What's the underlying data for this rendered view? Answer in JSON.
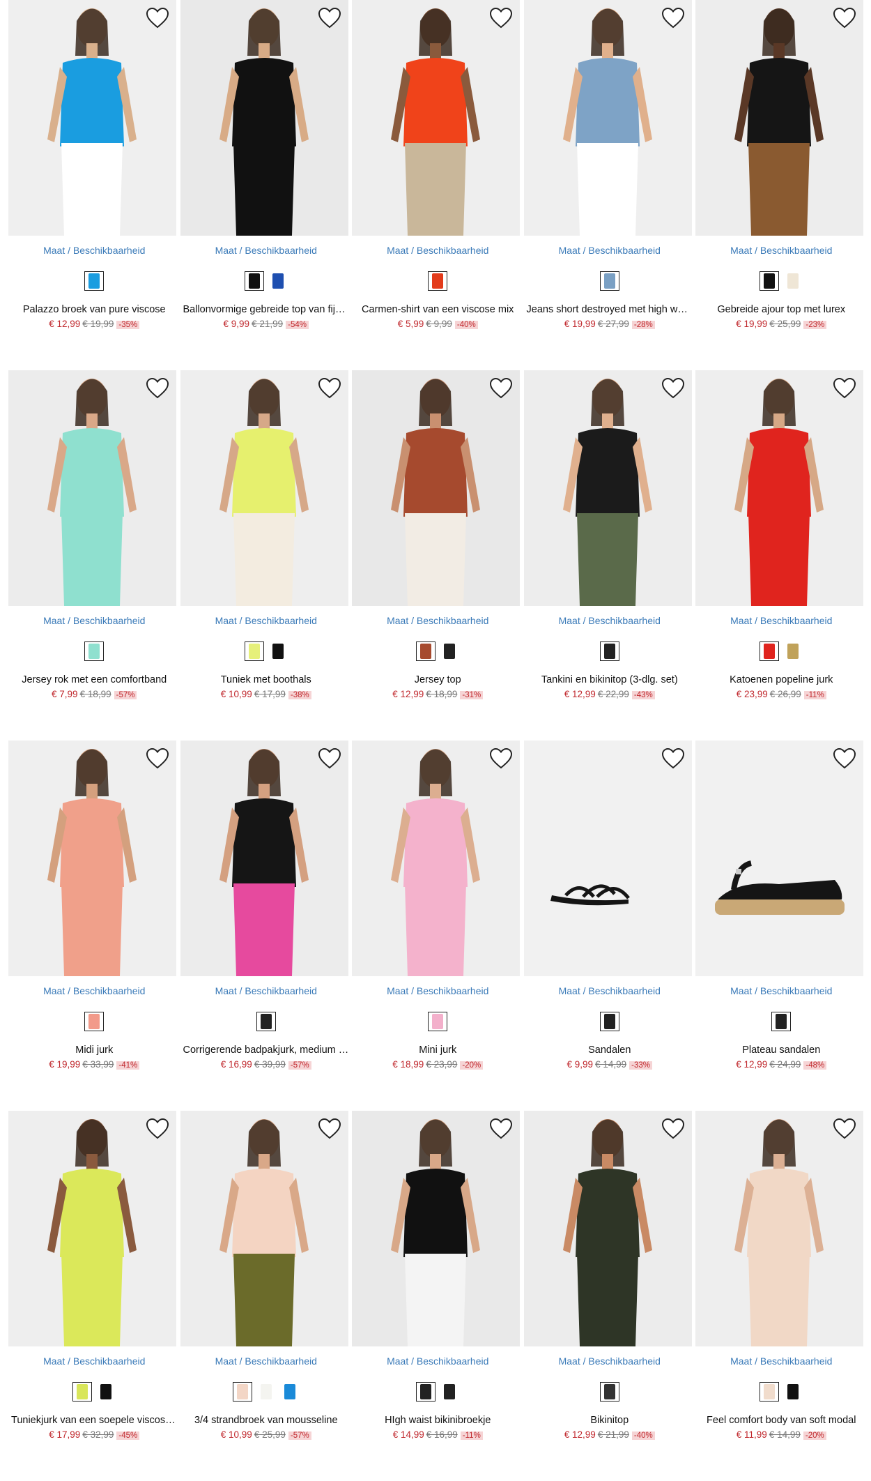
{
  "availability_label": "Maat / Beschikbaarheid",
  "products": [
    {
      "name": "Palazzo broek van pure viscose",
      "price": "€ 12,99",
      "old_price": "€ 19,99",
      "discount": "-35%",
      "swatches": [
        "#1a9de0"
      ],
      "bg": "#efefef",
      "main": "#1a9de0",
      "sub": "#ffffff",
      "skin": "#d9b08c"
    },
    {
      "name": "Ballonvormige gebreide top van fijn tricot",
      "price": "€ 9,99",
      "old_price": "€ 21,99",
      "discount": "-54%",
      "swatches": [
        "#111111",
        "#1e4fb0"
      ],
      "bg": "#e9e9e9",
      "main": "#111111",
      "sub": "#111111",
      "skin": "#d8ab86"
    },
    {
      "name": "Carmen-shirt van een viscose mix",
      "price": "€ 5,99",
      "old_price": "€ 9,99",
      "discount": "-40%",
      "swatches": [
        "#e33b1b"
      ],
      "bg": "#eeeeee",
      "main": "#f0431a",
      "sub": "#c9b79a",
      "skin": "#8a5a3c"
    },
    {
      "name": "Jeans short destroyed met high waist",
      "price": "€ 19,99",
      "old_price": "€ 27,99",
      "discount": "-28%",
      "swatches": [
        "#7aa0c4"
      ],
      "bg": "#efefef",
      "main": "#7ea3c6",
      "sub": "#ffffff",
      "skin": "#e0b08c"
    },
    {
      "name": "Gebreide ajour top met lurex",
      "price": "€ 19,99",
      "old_price": "€ 25,99",
      "discount": "-23%",
      "swatches": [
        "#111111",
        "#efe6d6"
      ],
      "bg": "#ededed",
      "main": "#151515",
      "sub": "#8a5a30",
      "skin": "#5a3826"
    },
    {
      "name": "Jersey rok met een comfortband",
      "price": "€ 7,99",
      "old_price": "€ 18,99",
      "discount": "-57%",
      "swatches": [
        "#8fe0cf"
      ],
      "bg": "#ececec",
      "main": "#8fe0cf",
      "sub": "#8fe0cf",
      "skin": "#d9a888"
    },
    {
      "name": "Tuniek met boothals",
      "price": "€ 10,99",
      "old_price": "€ 17,99",
      "discount": "-38%",
      "swatches": [
        "#e6f07a",
        "#111111"
      ],
      "bg": "#eeeeee",
      "main": "#e6f06e",
      "sub": "#f3ece0",
      "skin": "#d6a888"
    },
    {
      "name": "Jersey top",
      "price": "€ 12,99",
      "old_price": "€ 18,99",
      "discount": "-31%",
      "swatches": [
        "#a64a2e",
        "#222222"
      ],
      "bg": "#e8e8e8",
      "main": "#a64a2e",
      "sub": "#f2ece4",
      "skin": "#c99070"
    },
    {
      "name": "Tankini en bikinitop (3-dlg. set)",
      "price": "€ 12,99",
      "old_price": "€ 22,99",
      "discount": "-43%",
      "swatches": [
        "#222222"
      ],
      "bg": "#ededed",
      "main": "#1b1b1b",
      "sub": "#5a6a4a",
      "skin": "#e0b08e"
    },
    {
      "name": "Katoenen popeline jurk",
      "price": "€ 23,99",
      "old_price": "€ 26,99",
      "discount": "-11%",
      "swatches": [
        "#e0241e",
        "#c0a25a"
      ],
      "bg": "#eeeeee",
      "main": "#e0241e",
      "sub": "#e0241e",
      "skin": "#d6a886"
    },
    {
      "name": "Midi jurk",
      "price": "€ 19,99",
      "old_price": "€ 33,99",
      "discount": "-41%",
      "swatches": [
        "#f29a8a"
      ],
      "bg": "#efefef",
      "main": "#f0a08a",
      "sub": "#f0a08a",
      "skin": "#d4a07e"
    },
    {
      "name": "Corrigerende badpakjurk, medium shape",
      "price": "€ 16,99",
      "old_price": "€ 39,99",
      "discount": "-57%",
      "swatches": [
        "#222222"
      ],
      "bg": "#ececec",
      "main": "#151515",
      "sub": "#e64a9e",
      "skin": "#d4a080"
    },
    {
      "name": "Mini jurk",
      "price": "€ 18,99",
      "old_price": "€ 23,99",
      "discount": "-20%",
      "swatches": [
        "#f3b0cb"
      ],
      "bg": "#eeeeee",
      "main": "#f4b2cc",
      "sub": "#f4b2cc",
      "skin": "#dcae90"
    },
    {
      "name": "Sandalen",
      "price": "€ 9,99",
      "old_price": "€ 14,99",
      "discount": "-33%",
      "swatches": [
        "#222222"
      ],
      "bg": "#f1f1f1",
      "main": "#151515",
      "sub": "#151515",
      "skin": "#f1f1f1"
    },
    {
      "name": "Plateau sandalen",
      "price": "€ 12,99",
      "old_price": "€ 24,99",
      "discount": "-48%",
      "swatches": [
        "#222222"
      ],
      "bg": "#f1f1f1",
      "main": "#151515",
      "sub": "#c9a876",
      "skin": "#f1f1f1"
    },
    {
      "name": "Tuniekjurk van een soepele viscose mix",
      "price": "€ 17,99",
      "old_price": "€ 32,99",
      "discount": "-45%",
      "swatches": [
        "#d9e65a",
        "#111111"
      ],
      "bg": "#eeeeee",
      "main": "#dbe85a",
      "sub": "#dbe85a",
      "skin": "#8a5a3e"
    },
    {
      "name": "3/4 strandbroek van mousseline",
      "price": "€ 10,99",
      "old_price": "€ 25,99",
      "discount": "-57%",
      "swatches": [
        "#f3d6c6",
        "#f4f4f0",
        "#1a8ad8"
      ],
      "bg": "#ededed",
      "main": "#f4d4c2",
      "sub": "#6b6b2a",
      "skin": "#d9a888"
    },
    {
      "name": "HIgh waist bikinibroekje",
      "price": "€ 14,99",
      "old_price": "€ 16,99",
      "discount": "-11%",
      "swatches": [
        "#222222",
        "#222222"
      ],
      "bg": "#e9e9e9",
      "main": "#111111",
      "sub": "#f4f4f4",
      "skin": "#d8a888"
    },
    {
      "name": "Bikinitop",
      "price": "€ 12,99",
      "old_price": "€ 21,99",
      "discount": "-40%",
      "swatches": [
        "#333333"
      ],
      "bg": "#ececec",
      "main": "#2e3526",
      "sub": "#2e3526",
      "skin": "#c98a64"
    },
    {
      "name": "Feel comfort body van soft modal",
      "price": "€ 11,99",
      "old_price": "€ 14,99",
      "discount": "-20%",
      "swatches": [
        "#f1dccc",
        "#111111"
      ],
      "bg": "#eeeeee",
      "main": "#f1d8c6",
      "sub": "#f1d8c6",
      "skin": "#dcb094"
    }
  ]
}
